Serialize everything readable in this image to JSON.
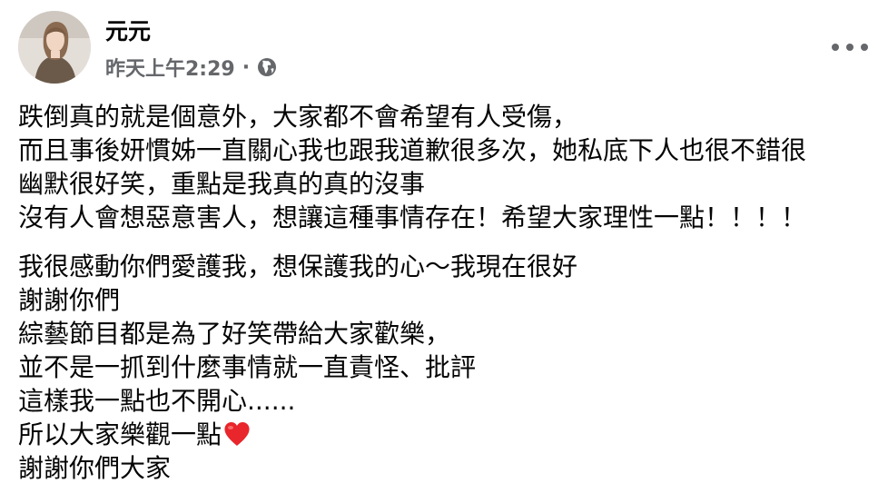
{
  "post": {
    "author": "元元",
    "timestamp": "昨天上午2:29",
    "separator": "·",
    "audience_icon": "globe-icon",
    "more_icon": "more-options-icon",
    "paragraphs": [
      {
        "lines": [
          "跌倒真的就是個意外，大家都不會希望有人受傷，",
          "而且事後妍慣姊一直關心我也跟我道歉很多次，她私底下人也很不錯很",
          "幽默很好笑，重點是我真的真的沒事",
          "沒有人會想惡意害人，想讓這種事情存在！希望大家理性一點！！！！"
        ]
      },
      {
        "lines": [
          "我很感動你們愛護我，想保護我的心～我現在很好",
          "謝謝你們",
          "綜藝節目都是為了好笑帶給大家歡樂，",
          "並不是一抓到什麼事情就一直責怪、批評",
          "這樣我一點也不開心......",
          "所以大家樂觀一點",
          "謝謝你們大家"
        ],
        "emoji_after_line_index": 5,
        "emoji": "red-heart-icon"
      }
    ]
  },
  "colors": {
    "text": "#050505",
    "secondary_text": "#65676b",
    "heart": "#e8262b",
    "background": "#ffffff"
  }
}
